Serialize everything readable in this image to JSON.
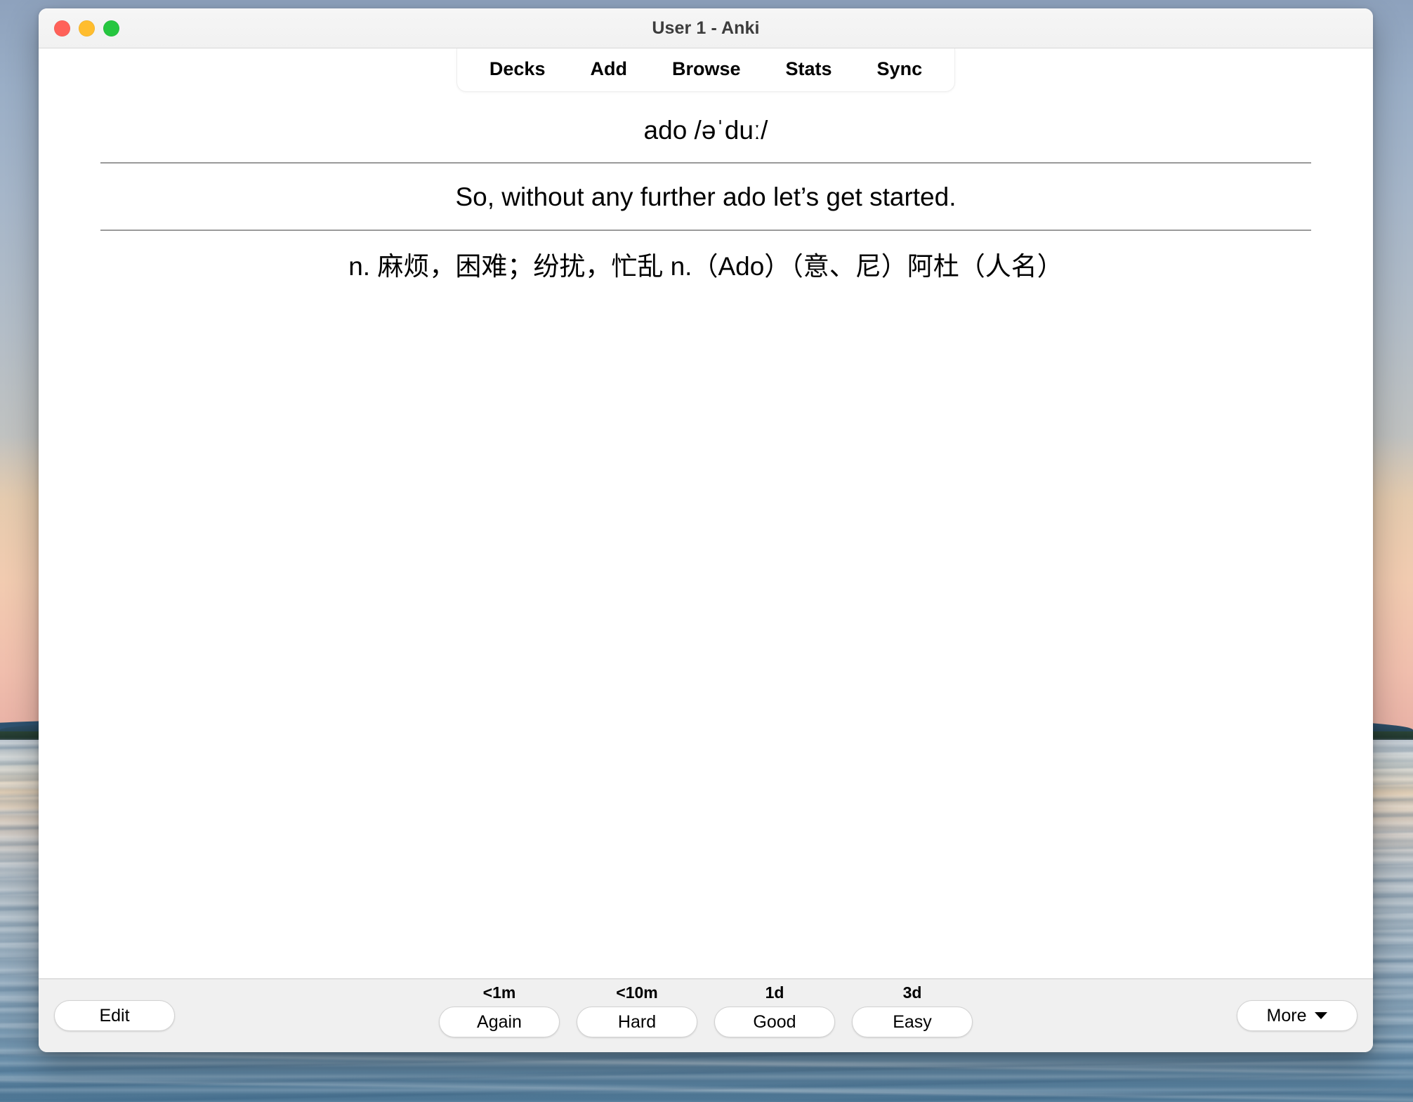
{
  "window": {
    "title": "User 1 - Anki",
    "traffic_lights": [
      {
        "name": "close",
        "color": "#ff6159"
      },
      {
        "name": "minimize",
        "color": "#ffbd2e"
      },
      {
        "name": "maximize",
        "color": "#25c63f"
      }
    ]
  },
  "nav": {
    "items": [
      {
        "label": "Decks"
      },
      {
        "label": "Add"
      },
      {
        "label": "Browse"
      },
      {
        "label": "Stats"
      },
      {
        "label": "Sync"
      }
    ]
  },
  "card": {
    "front": "ado /əˈduː/",
    "sentence": "So, without any further ado let’s get started.",
    "definition": "n. 麻烦，困难；纷扰，忙乱 n.（Ado）（意、尼）阿杜（人名）"
  },
  "toolbar": {
    "edit_label": "Edit",
    "more_label": "More",
    "more_caret_icon": "chevron-down-icon"
  },
  "answers": [
    {
      "interval": "<1m",
      "label": "Again"
    },
    {
      "interval": "<10m",
      "label": "Hard"
    },
    {
      "interval": "1d",
      "label": "Good"
    },
    {
      "interval": "3d",
      "label": "Easy"
    }
  ]
}
